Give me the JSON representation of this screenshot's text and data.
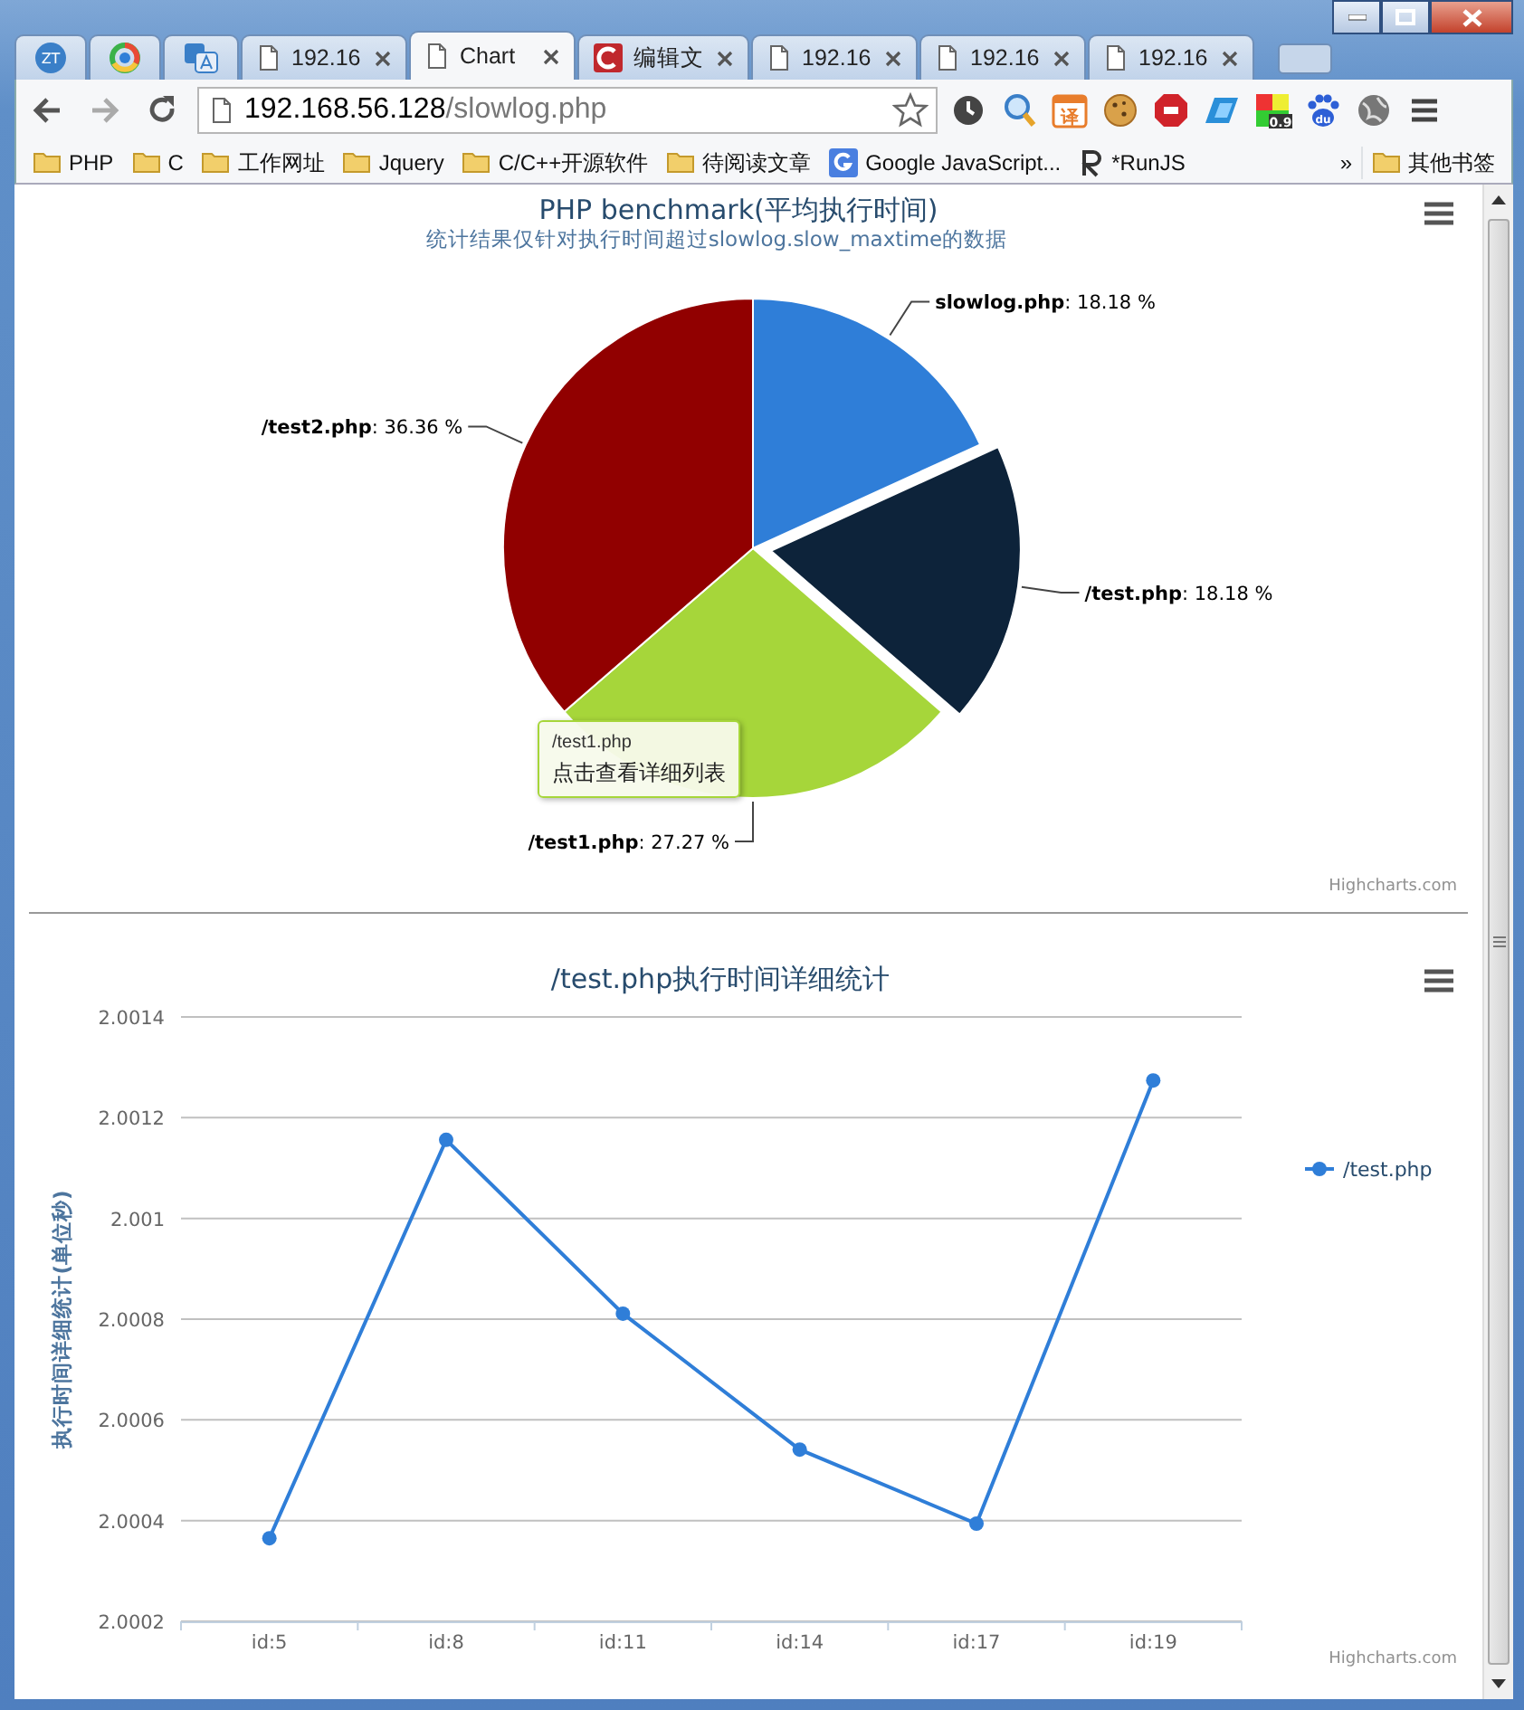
{
  "browser": {
    "tabs": [
      {
        "kind": "zt",
        "icon_text": "ZT",
        "selected": false
      },
      {
        "kind": "ring",
        "selected": false
      },
      {
        "kind": "translate",
        "selected": false
      },
      {
        "kind": "page",
        "label": "192.16",
        "selected": false
      },
      {
        "kind": "page",
        "label": "Chart",
        "selected": true
      },
      {
        "kind": "clogo",
        "label": "编辑文",
        "selected": false
      },
      {
        "kind": "page",
        "label": "192.16",
        "selected": false
      },
      {
        "kind": "page",
        "label": "192.16",
        "selected": false
      },
      {
        "kind": "page",
        "label": "192.16",
        "selected": false
      }
    ],
    "address": {
      "host": "192.168.56.128",
      "path": "/slowlog.php"
    },
    "extensions": [
      {
        "kind": "clock"
      },
      {
        "kind": "magnifier"
      },
      {
        "kind": "dict",
        "text": "译"
      },
      {
        "kind": "cookie"
      },
      {
        "kind": "stop"
      },
      {
        "kind": "slant"
      },
      {
        "kind": "palette",
        "text": "0.9"
      },
      {
        "kind": "paw",
        "text": "du"
      },
      {
        "kind": "globe"
      },
      {
        "kind": "menu"
      }
    ],
    "bookmarks": [
      {
        "kind": "folder",
        "label": "PHP"
      },
      {
        "kind": "folder",
        "label": "C"
      },
      {
        "kind": "folder",
        "label": "工作网址"
      },
      {
        "kind": "folder",
        "label": "Jquery"
      },
      {
        "kind": "folder",
        "label": "C/C++开源软件"
      },
      {
        "kind": "folder",
        "label": "待阅读文章"
      },
      {
        "kind": "google",
        "label": "Google JavaScript..."
      },
      {
        "kind": "runjs",
        "label": "*RunJS"
      }
    ],
    "overflow": "»",
    "other_bookmarks": "其他书签"
  },
  "charts": [
    {
      "title": "PHP benchmark(平均执行时间)",
      "subtitle": "统计结果仅针对执行时间超过slowlog.slow_maxtime的数据",
      "credits": "Highcharts.com",
      "chart_data": {
        "type": "pie",
        "categories": [
          "slowlog.php",
          "/test.php",
          "/test1.php",
          "/test2.php"
        ],
        "values": [
          18.18,
          18.18,
          27.27,
          36.36
        ]
      },
      "slices": [
        {
          "value_label": ": 18.18 %",
          "color": "#2f7ed8",
          "sliced": false
        },
        {
          "value_label": ": 18.18 %",
          "color": "#0d233a",
          "sliced": true
        },
        {
          "value_label": ": 27.27 %",
          "color": "#a6d63a",
          "sliced": false
        },
        {
          "value_label": ": 36.36 %",
          "color": "#910000",
          "sliced": false
        }
      ],
      "tooltip": {
        "title": "/test1.php",
        "text": "点击查看详细列表"
      }
    },
    {
      "title": "/test.php执行时间详细统计",
      "credits": "Highcharts.com",
      "chart_data": {
        "type": "line",
        "ylabel": "执行时间详细统计(单位秒)",
        "categories": [
          "id:5",
          "id:8",
          "id:11",
          "id:14",
          "id:17",
          "id:19"
        ],
        "grid": true,
        "series": [
          {
            "name": "/test.php",
            "color": "#2f7ed8",
            "marker": true,
            "values": [
              2.000365,
              2.001156,
              2.000811,
              2.000541,
              2.000394,
              2.001274
            ]
          }
        ],
        "ylim": [
          2.0002,
          2.0014
        ],
        "yticks": [
          2.0002,
          2.0004,
          2.0006,
          2.0008,
          2.001,
          2.0012,
          2.0014
        ]
      }
    }
  ]
}
